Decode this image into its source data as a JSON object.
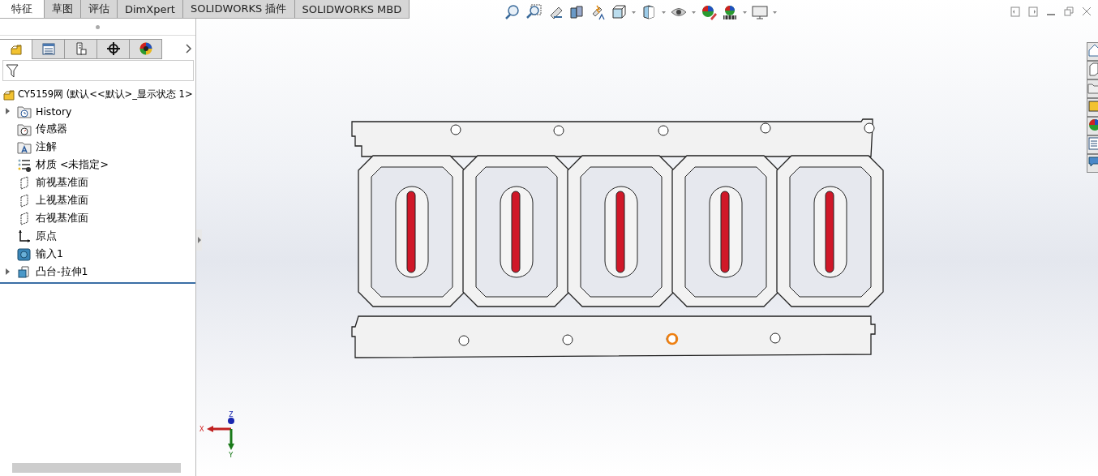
{
  "command_tabs": [
    {
      "label": "特征",
      "selected": true
    },
    {
      "label": "草图",
      "selected": false
    },
    {
      "label": "评估",
      "selected": false
    },
    {
      "label": "DimXpert",
      "selected": false
    },
    {
      "label": "SOLIDWORKS 插件",
      "selected": false
    },
    {
      "label": "SOLIDWORKS MBD",
      "selected": false
    }
  ],
  "panel_tabs": [
    {
      "kind": "feature",
      "selected": true
    },
    {
      "kind": "property",
      "selected": false
    },
    {
      "kind": "config",
      "selected": false
    },
    {
      "kind": "dimxpert",
      "selected": false
    },
    {
      "kind": "display",
      "selected": false
    }
  ],
  "tree": {
    "root": "CY5159网 (默认<<默认>_显示状态 1>",
    "items": [
      {
        "label": "History",
        "kind": "history",
        "expandable": true
      },
      {
        "label": "传感器",
        "kind": "sensor",
        "expandable": false
      },
      {
        "label": "注解",
        "kind": "annotation",
        "expandable": false
      },
      {
        "label": "材质 <未指定>",
        "kind": "material",
        "expandable": false
      },
      {
        "label": "前视基准面",
        "kind": "plane",
        "expandable": false
      },
      {
        "label": "上视基准面",
        "kind": "plane",
        "expandable": false
      },
      {
        "label": "右视基准面",
        "kind": "plane",
        "expandable": false
      },
      {
        "label": "原点",
        "kind": "origin",
        "expandable": false
      },
      {
        "label": "输入1",
        "kind": "import",
        "expandable": false
      },
      {
        "label": "凸台-拉伸1",
        "kind": "extrude",
        "expandable": true
      }
    ]
  },
  "triad": {
    "x": "X",
    "y": "Y",
    "z": "Z"
  }
}
